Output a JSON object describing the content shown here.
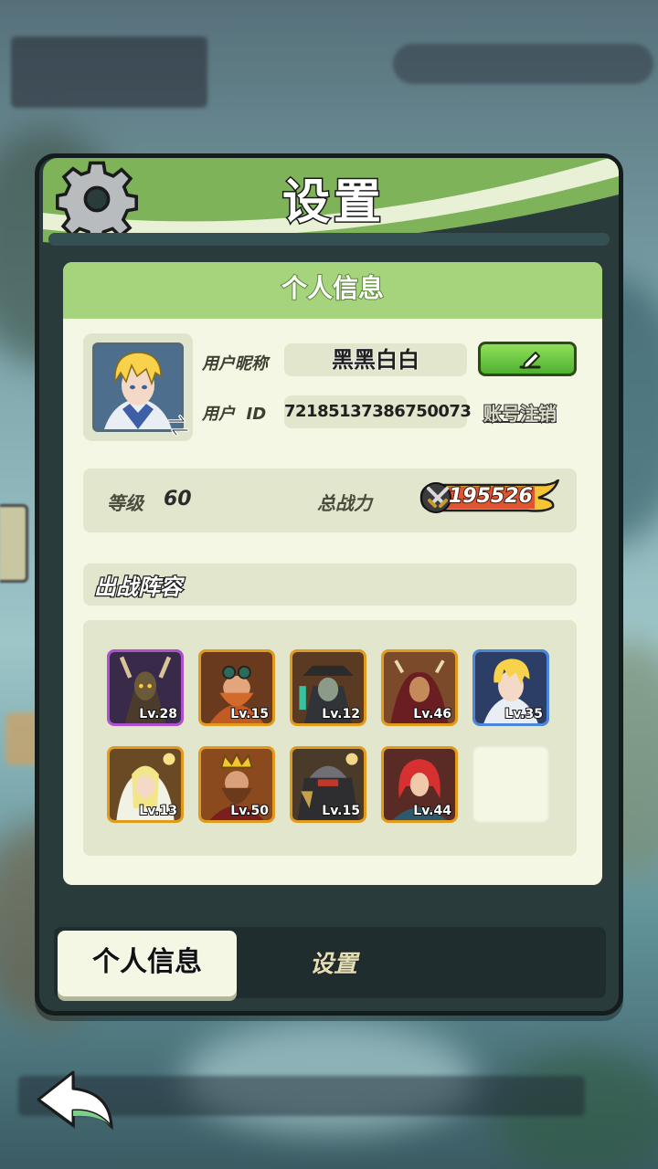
{
  "panel": {
    "title": "设置",
    "card_title": "个人信息"
  },
  "profile": {
    "nickname_label": "用户昵称",
    "nickname": "黑黑白白",
    "id_label": "用户  ID",
    "user_id": "72185137386750073",
    "cancel_account_label": "账号注销"
  },
  "stats": {
    "level_label": "等级",
    "level_value": "60",
    "power_label": "总战力",
    "power_value": "195526"
  },
  "lineup": {
    "title": "出战阵容",
    "heroes": [
      {
        "level": "Lv.28",
        "rarity_color": "#b04fd0"
      },
      {
        "level": "Lv.15",
        "rarity_color": "#e29a1c"
      },
      {
        "level": "Lv.12",
        "rarity_color": "#e29a1c"
      },
      {
        "level": "Lv.46",
        "rarity_color": "#e29a1c"
      },
      {
        "level": "Lv.35",
        "rarity_color": "#4a86d9"
      },
      {
        "level": "Lv.13",
        "rarity_color": "#e29a1c"
      },
      {
        "level": "Lv.50",
        "rarity_color": "#e29a1c"
      },
      {
        "level": "Lv.15",
        "rarity_color": "#e29a1c"
      },
      {
        "level": "Lv.44",
        "rarity_color": "#e29a1c"
      },
      {
        "level": "",
        "rarity_color": ""
      }
    ]
  },
  "tabs": {
    "active": "个人信息",
    "inactive": "设置"
  },
  "icons": {
    "gear": "gear-icon",
    "edit": "pencil-icon",
    "swap": "swap-arrows-icon",
    "power": "crossed-swords-icon",
    "back": "back-arrow-icon"
  },
  "colors": {
    "accent_green": "#7fb35a",
    "card_bg": "#f4f7e3",
    "edit_button": "#5cc23a"
  }
}
